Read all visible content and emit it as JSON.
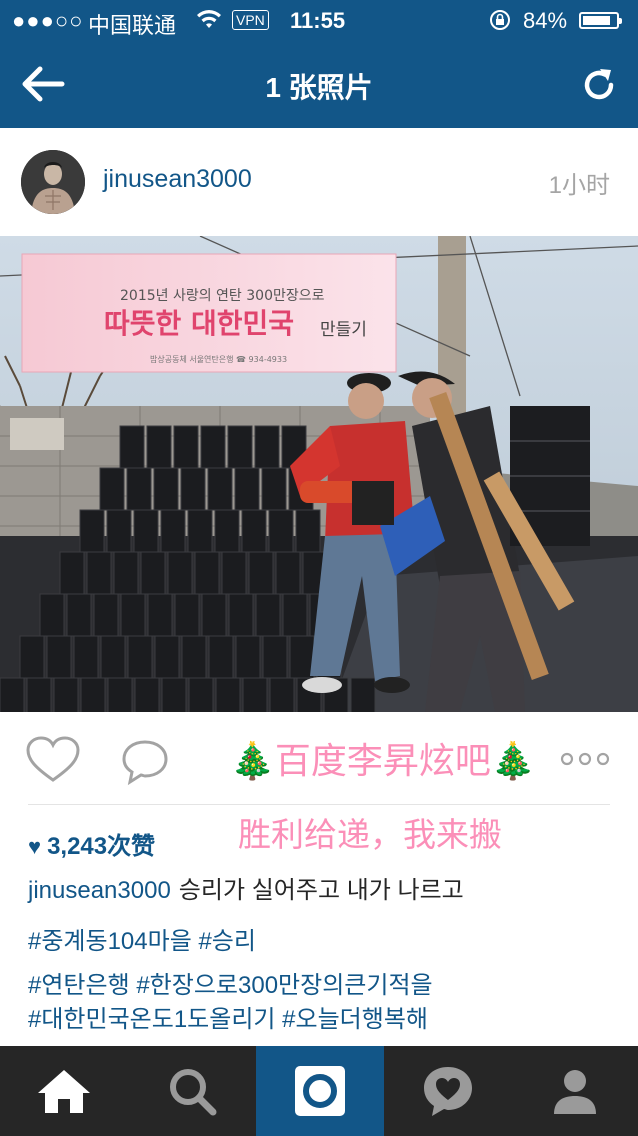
{
  "status_bar": {
    "signal": "●●●○○",
    "carrier": "中国联通",
    "wifi_icon": "wifi-icon",
    "vpn": "VPN",
    "time": "11:55",
    "lock_icon": "rotation-lock-icon",
    "battery_percent": "84%",
    "battery_level": 0.84
  },
  "nav": {
    "title": "1 张照片",
    "back_icon": "back-arrow-icon",
    "refresh_icon": "refresh-icon",
    "bg_color": "#125688"
  },
  "post": {
    "username": "jinusean3000",
    "time_ago": "1小时",
    "photo_banner": {
      "line1": "2015년 사랑의 연탄 300만장으로",
      "line2": "따뜻한 대한민국",
      "line2_suffix": "만들기",
      "footer": "밥상공동체 서울연탄은행 ☎ 934-4933"
    },
    "watermark": "🎄百度李昇炫吧🎄",
    "overlay_caption": "胜利给递，我来搬",
    "likes": "3,243次赞",
    "caption_user": "jinusean3000",
    "caption_text": "승리가 실어주고 내가 나르고",
    "tags_line1": "#중계동104마을 #승리",
    "tags_line2": "#연탄은행 #한장으로300만장의큰기적을",
    "tags_line3": "#대한민국온도1도올리기 #오늘더행복해"
  },
  "tab_bar": {
    "tabs": [
      "home-icon",
      "search-icon",
      "camera-icon",
      "activity-icon",
      "profile-icon"
    ],
    "active_index": 2
  }
}
